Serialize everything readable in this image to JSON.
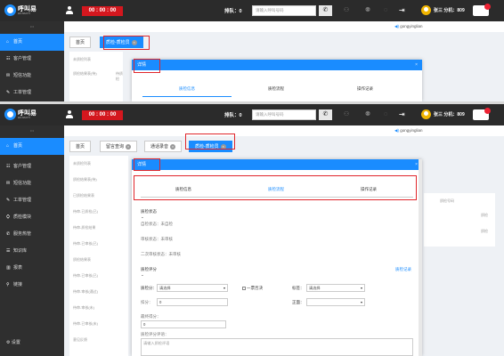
{
  "topbar": {
    "logo_name": "呼叫易",
    "logo_sub": "HUJIAOYI",
    "timer": "00 : 00 : 00",
    "queue_label": "排队：0",
    "phone_placeholder": "请输入呼叫号码",
    "agent_info": "张三  分机：809"
  },
  "voice": {
    "user": "gongyinglian"
  },
  "sidebar": {
    "items": [
      {
        "icon": "⌂",
        "label": "首页",
        "active": true
      },
      {
        "icon": "☷",
        "label": "客户管理"
      },
      {
        "icon": "✉",
        "label": "短信功能"
      },
      {
        "icon": "✎",
        "label": "工单管理"
      },
      {
        "icon": "⛭",
        "label": "质检模块"
      },
      {
        "icon": "✆",
        "label": "服务热管"
      },
      {
        "icon": "☰",
        "label": "知识库"
      },
      {
        "icon": "▥",
        "label": "报表"
      },
      {
        "icon": "⚲",
        "label": "链接"
      }
    ],
    "settings": "设置"
  },
  "top_shot": {
    "tabs": [
      "首页",
      "质检-质检员"
    ],
    "modal_title": "详情",
    "modal_tabs": [
      "质检信息",
      "质检流程",
      "操作记录"
    ],
    "bg_rows": [
      "未质检列表",
      "质检结果表(待)",
      "待质检"
    ]
  },
  "bottom_shot": {
    "tabs": [
      "首页",
      "留言查询",
      "通话录音",
      "质检-质检员"
    ],
    "modal_title": "详情",
    "modal_tabs": [
      "质检信息",
      "质检流程",
      "操作记录"
    ],
    "bg_rows": [
      "未质检列表",
      "质检结果表(待)",
      "已质检结果表",
      "待审-已质检(已)",
      "待审-质检结果",
      "待审-已审核(已)",
      "质检结果表",
      "待审-已审核(已)",
      "待审-审核(通过)",
      "待审-审核(未)",
      "待审-已审核(未)",
      "意见反馈"
    ],
    "right_labels": [
      "质检号码",
      "质检",
      "质检"
    ],
    "status_title": "质检状态",
    "status_items": [
      "自检状态：未自检",
      "审核状态：未审核",
      "二次审核状态：未审核"
    ],
    "score_title": "质检评分",
    "record_link": "质检记录",
    "score_label": "质检分：",
    "score_value": "请选择",
    "one_vote": "一票否决",
    "tag_label": "标签：",
    "tag_value": "请选择",
    "deduct_label": "扣分：",
    "deduct_value": "0",
    "positive_label": "正面：",
    "final_label": "最终得分：",
    "final_value": "0",
    "comment_label": "质检评分评语：",
    "comment_placeholder": "请输入质检评语"
  }
}
